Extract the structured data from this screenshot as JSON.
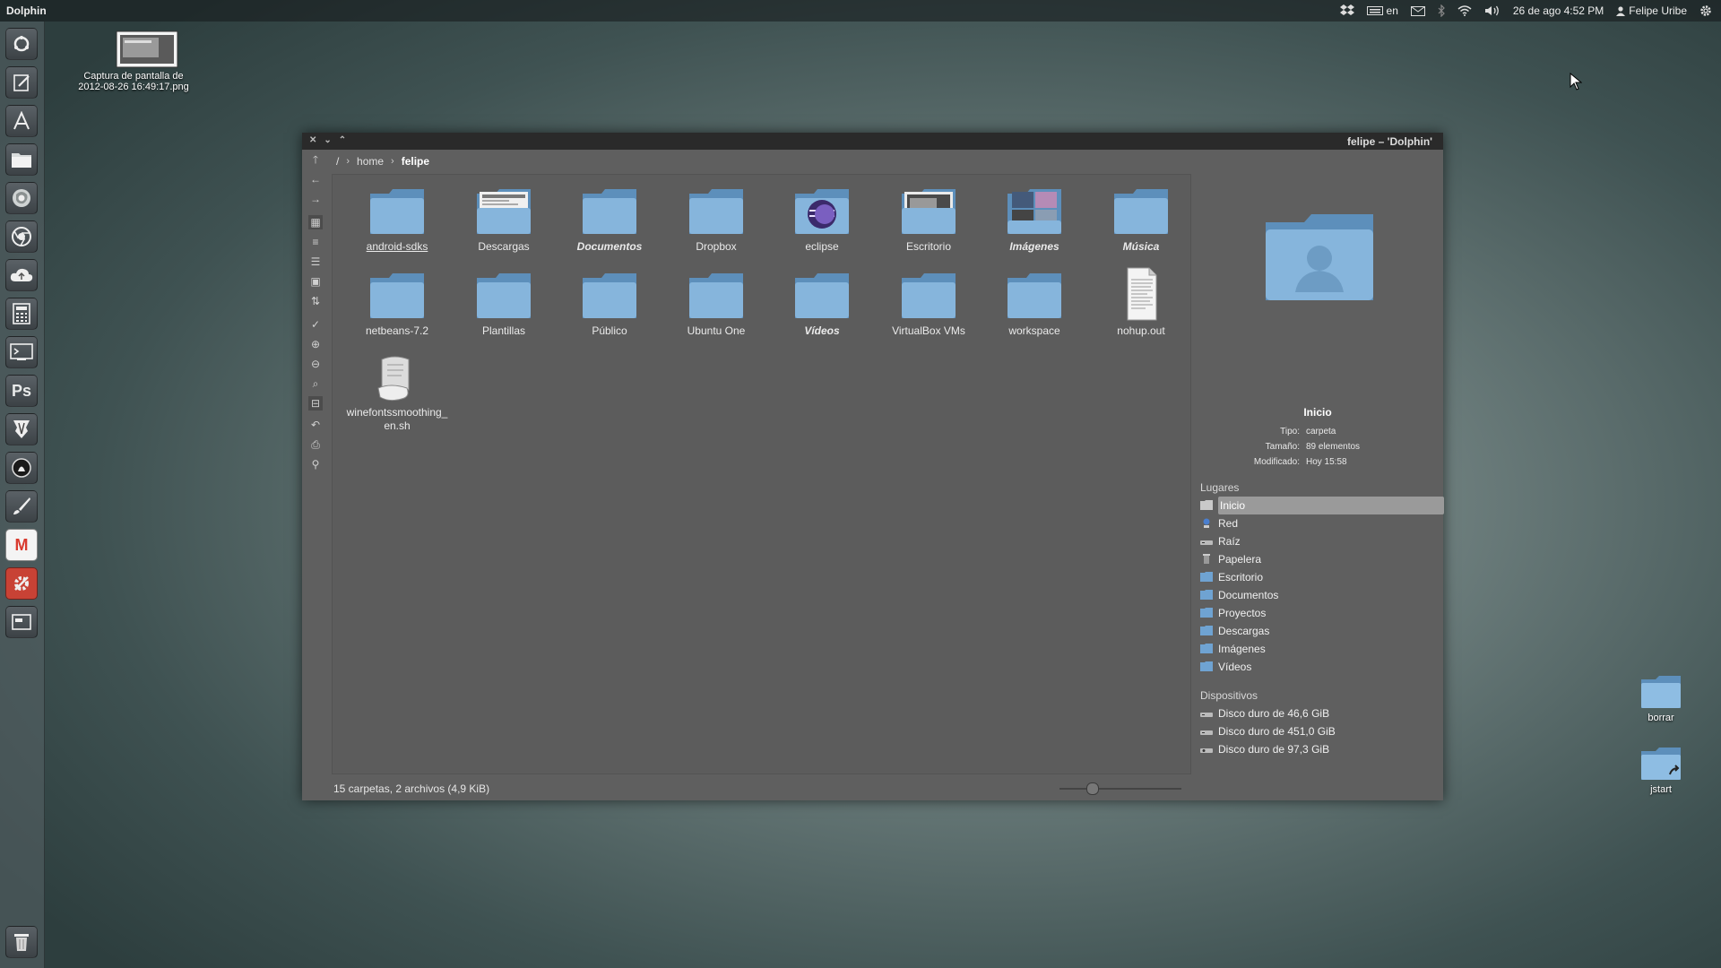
{
  "top_panel": {
    "app_title": "Dolphin",
    "keyboard_layout": "en",
    "datetime": "26 de ago  4:52 PM",
    "user": "Felipe Uribe"
  },
  "launcher": {
    "icons": [
      "ubuntu-home-icon",
      "text-editor-icon",
      "software-center-icon",
      "files-icon",
      "firefox-icon",
      "chromium-icon",
      "cloud-icon",
      "calculator-icon",
      "terminal-icon",
      "photoshop-icon",
      "inkscape-icon",
      "gimp-icon",
      "brush-icon",
      "gmail-icon",
      "settings-icon",
      "window-icon",
      "trash-icon"
    ],
    "photoshop_label": "Ps",
    "gmail_label": "M"
  },
  "desktop": {
    "screenshot_file": {
      "line1": "Captura de pantalla de",
      "line2": "2012-08-26 16:49:17.png"
    },
    "borrar": "borrar",
    "jstart": "jstart"
  },
  "window": {
    "title": "felipe – 'Dolphin'",
    "breadcrumb": [
      "/",
      "home",
      "felipe"
    ],
    "files": [
      {
        "name": "android-sdks",
        "type": "folder"
      },
      {
        "name": "Descargas",
        "type": "folder"
      },
      {
        "name": "Documentos",
        "type": "folder"
      },
      {
        "name": "Dropbox",
        "type": "folder"
      },
      {
        "name": "eclipse",
        "type": "folder"
      },
      {
        "name": "Escritorio",
        "type": "folder"
      },
      {
        "name": "Imágenes",
        "type": "folder"
      },
      {
        "name": "Música",
        "type": "folder"
      },
      {
        "name": "netbeans-7.2",
        "type": "folder"
      },
      {
        "name": "Plantillas",
        "type": "folder"
      },
      {
        "name": "Público",
        "type": "folder"
      },
      {
        "name": "Ubuntu One",
        "type": "folder"
      },
      {
        "name": "Vídeos",
        "type": "folder"
      },
      {
        "name": "VirtualBox VMs",
        "type": "folder"
      },
      {
        "name": "workspace",
        "type": "folder"
      },
      {
        "name": "nohup.out",
        "type": "text-file"
      },
      {
        "name_line1": "winefontssmoothing_",
        "name_line2": "en.sh",
        "type": "script"
      }
    ],
    "status": "15 carpetas, 2 archivos (4,9 KiB)",
    "info": {
      "title": "Inicio",
      "tipo_label": "Tipo:",
      "tipo": "carpeta",
      "tamano_label": "Tamaño:",
      "tamano": "89 elementos",
      "modificado_label": "Modificado:",
      "modificado": "Hoy 15:58"
    },
    "places_title": "Lugares",
    "places": [
      "Inicio",
      "Red",
      "Raíz",
      "Papelera",
      "Escritorio",
      "Documentos",
      "Proyectos",
      "Descargas",
      "Imágenes",
      "Vídeos"
    ],
    "devices_title": "Dispositivos",
    "devices": [
      "Disco duro de 46,6 GiB",
      "Disco duro de 451,0 GiB",
      "Disco duro de 97,3 GiB"
    ]
  },
  "colors": {
    "folder": "#7fb0d8",
    "folder_dark": "#5d8fbb",
    "selection": "#9a9a9a"
  }
}
